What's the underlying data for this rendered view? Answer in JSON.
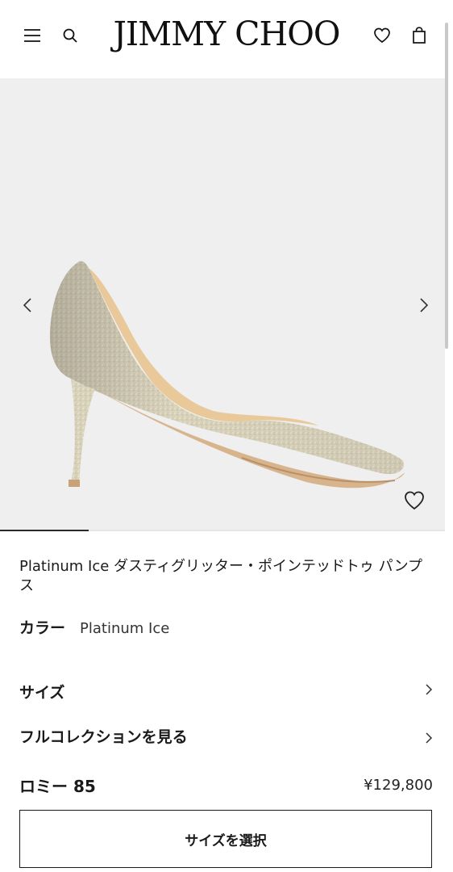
{
  "header": {
    "logo": "JIMMY CHOO",
    "menu_icon": "menu-icon",
    "search_icon": "search-icon",
    "wishlist_icon": "heart-icon",
    "bag_icon": "shopping-bag-icon"
  },
  "gallery": {
    "prev_icon": "chevron-left-icon",
    "next_icon": "chevron-right-icon",
    "favorite_icon": "heart-outline-icon",
    "background_color": "#efefef",
    "product_color": "#d8d0b6",
    "progress": 0.2
  },
  "product": {
    "title_prefix": "Platinum Ice",
    "title_rest": "ダスティグリッター・ポインテッドトゥ パンプス",
    "color_label": "カラー",
    "color_value": "Platinum Ice",
    "size_label": "サイズ",
    "collection_label": "フルコレクションを見る",
    "name": "ロミー 85",
    "price": "¥129,800",
    "select_size_button": "サイズを選択"
  }
}
